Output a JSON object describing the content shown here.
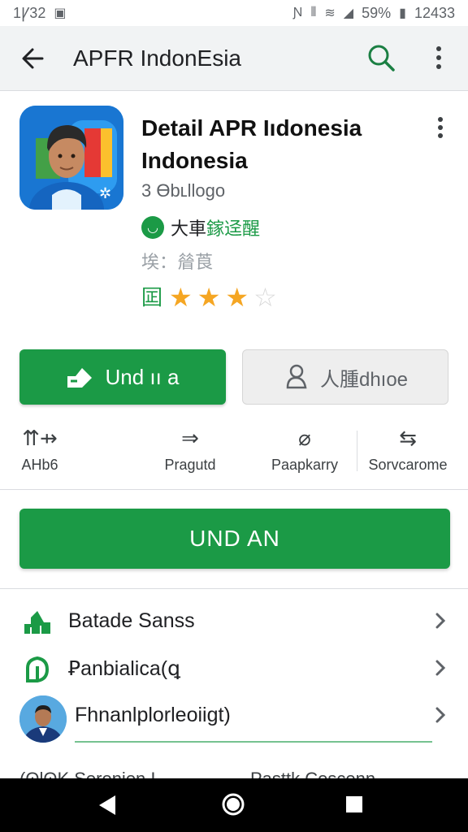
{
  "status_bar": {
    "time_left": "1Ꝩ32",
    "battery": "59%",
    "clock": "12433"
  },
  "app_bar": {
    "title": "APFR IndonEsia"
  },
  "app": {
    "title": "Detail APR Iıdonesia Indonesia",
    "developer": "3 Ɵbʟllogo",
    "badge_text_1": "大車",
    "badge_text_2": "鎵迳醒",
    "category": "埃：䁞莨",
    "rating": 3,
    "rating_max": 5
  },
  "buttons": {
    "primary": "Und ıı a",
    "secondary": "人腫dhıoe"
  },
  "stats": [
    {
      "glyph": "⇈⇸",
      "label": "AHb6"
    },
    {
      "glyph": "⇒",
      "label": "Pragutd"
    },
    {
      "glyph": "⌀",
      "label": "Paapkarry"
    },
    {
      "glyph": "⇆",
      "label": "Sorvcarome"
    }
  ],
  "install": {
    "label": "UND AN"
  },
  "list": [
    {
      "label": "Batade Sanss",
      "icon": "chart-icon"
    },
    {
      "label": "Ꝑanbialica(ꝗ",
      "icon": "leaf-icon"
    },
    {
      "label": "Fhnanlplorleoiigt)",
      "icon": "avatar"
    }
  ],
  "footer": {
    "left": "(ʘlʘK Soronion  I",
    "right": "Pasttk Cosconn"
  },
  "colors": {
    "accent": "#1b9a46",
    "star": "#f5a623"
  }
}
